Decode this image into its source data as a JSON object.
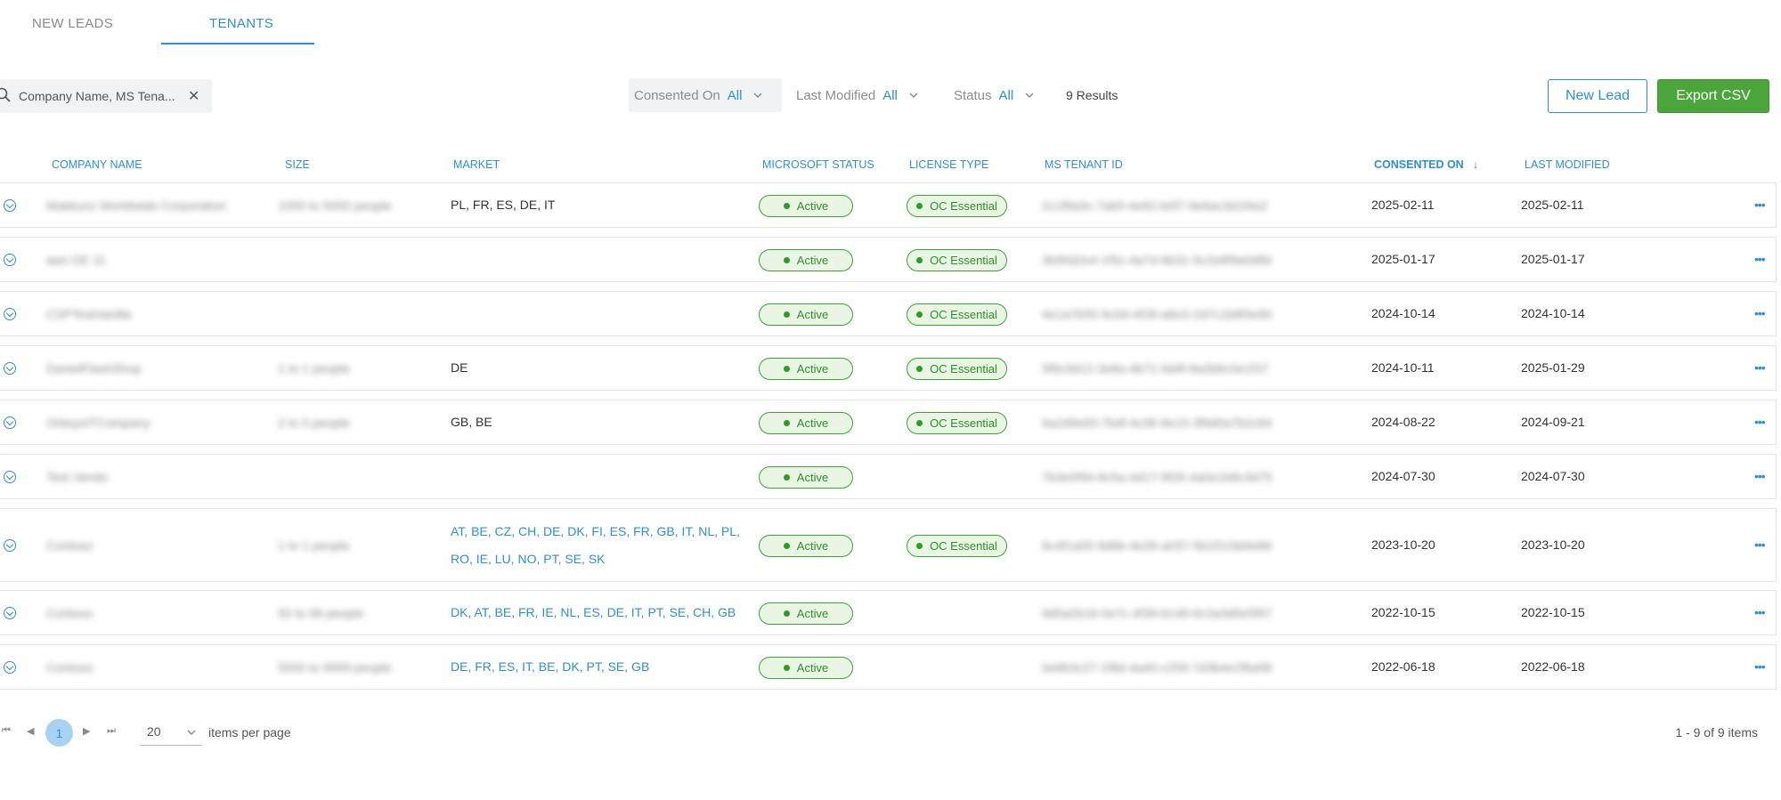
{
  "tabs": [
    {
      "label": "NEW LEADS"
    },
    {
      "label": "TENANTS"
    }
  ],
  "search": {
    "value": "Company Name, MS Tena...",
    "clear": "✕"
  },
  "filters": [
    {
      "label": "Consented On",
      "value": "All"
    },
    {
      "label": "Last Modified",
      "value": "All"
    },
    {
      "label": "Status",
      "value": "All"
    }
  ],
  "results": "9 Results",
  "buttons": {
    "new_lead": "New Lead",
    "export_csv": "Export CSV"
  },
  "columns": {
    "company": "COMPANY NAME",
    "size": "SIZE",
    "market": "MARKET",
    "ms_status": "MICROSOFT STATUS",
    "license": "LICENSE TYPE",
    "tenant_id": "MS TENANT ID",
    "consented": "CONSENTED ON",
    "modified": "LAST MODIFIED",
    "sort_arrow": "↓"
  },
  "rows": [
    {
      "company": "Makkunz Worldwide Corporation",
      "size": "1000 to 5000 people",
      "market": "PL, FR, ES, DE, IT",
      "status": "Active",
      "license": "OC Essential",
      "tenant": "2c1f8a3c-7ab5-4e92-b0f7-9e6ac3d1f4a2",
      "consented": "2025-02-11",
      "modified": "2025-02-11",
      "more": "•••"
    },
    {
      "company": "aws DE 11",
      "size": "",
      "market": "",
      "status": "Active",
      "license": "OC Essential",
      "tenant": "3b90d2e4-1f5c-4a7d-8b31-5c2e8f9a0d6b",
      "consented": "2025-01-17",
      "modified": "2025-01-17",
      "more": "•••"
    },
    {
      "company": "CSPTestVanilla",
      "size": "",
      "market": "",
      "status": "Active",
      "license": "OC Essential",
      "tenant": "4e1a7b55-9c0d-4f28-a6e3-2d7c1b8f3e90",
      "consented": "2024-10-14",
      "modified": "2024-10-14",
      "more": "•••"
    },
    {
      "company": "DanielFlashShop",
      "size": "1 to 1 people",
      "market": "DE",
      "status": "Active",
      "license": "OC Essential",
      "tenant": "5f6c0d12-3e8a-4b71-9d4f-8a2b6c0e1f37",
      "consented": "2024-10-11",
      "modified": "2025-01-29",
      "more": "•••"
    },
    {
      "company": "OrbsysITCompany",
      "size": "2 to 5 people",
      "market": "GB, BE",
      "status": "Active",
      "license": "OC Essential",
      "tenant": "6a2d9e83-7b4f-4c06-8e15-3f9d0a7b2c64",
      "consented": "2024-08-22",
      "modified": "2024-09-21",
      "more": "•••"
    },
    {
      "company": "Test Vendo",
      "size": "",
      "market": "",
      "status": "Active",
      "license": "",
      "tenant": "7b3e0f94-8c5a-4d17-9f26-4a0e1b8c3d75",
      "consented": "2024-07-30",
      "modified": "2024-07-30",
      "more": "•••"
    },
    {
      "company": "Contoso",
      "size": "1 to 1 people",
      "market": "AT, BE, CZ, CH, DE, DK, FI, ES, FR, GB, IT, NL, PL, RO, IE, LU, NO, PT, SE, SK",
      "status": "Active",
      "license": "OC Essential",
      "tenant": "8c4f1a05-9d6b-4e28-a037-5b1f2c9d4e86",
      "consented": "2023-10-20",
      "modified": "2023-10-20",
      "more": "•••"
    },
    {
      "company": "Contoso",
      "size": "50 to 99 people",
      "market": "DK, AT, BE, FR, IE, NL, ES, DE, IT, PT, SE, CH, GB",
      "status": "Active",
      "license": "",
      "tenant": "9d5a2b16-0e7c-4f39-b148-6c2a3d0e5f97",
      "consented": "2022-10-15",
      "modified": "2022-10-15",
      "more": "•••"
    },
    {
      "company": "Contoso",
      "size": "5000 to 9999 people",
      "market": "DE, FR, ES, IT, BE, DK, PT, SE, GB",
      "status": "Active",
      "license": "",
      "tenant": "0e6b3c27-1f8d-4a40-c259-7d3b4e1f6a08",
      "consented": "2022-06-18",
      "modified": "2022-06-18",
      "more": "•••"
    }
  ],
  "pager": {
    "first": "⏮",
    "prev": "◀",
    "page": "1",
    "next": "▶",
    "last": "⏭",
    "page_size": "20",
    "items_per_page": "items per page",
    "info": "1 - 9 of 9 items"
  },
  "colors": {
    "accent": "#2d8fd5",
    "export": "#4aa63a",
    "badge_green": "#3aa532"
  }
}
